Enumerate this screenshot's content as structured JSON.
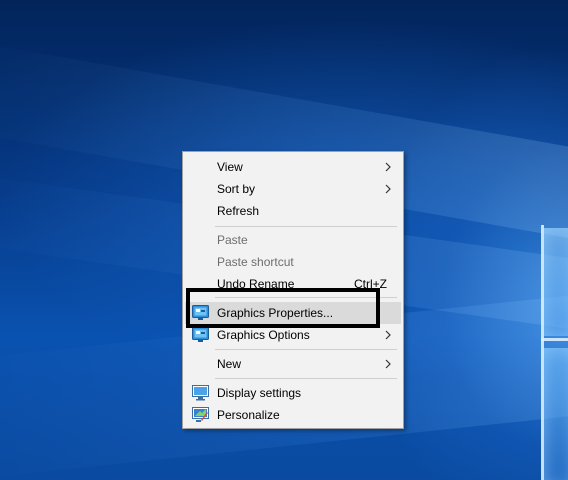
{
  "colors": {
    "menu_background": "#f2f2f2",
    "menu_hover": "#dadada",
    "disabled_text": "#6d6d6d",
    "highlight_box": "#000000",
    "desktop_blue": "#0a52b0"
  },
  "context_menu": {
    "view": {
      "label": "View",
      "has_submenu": true
    },
    "sort_by": {
      "label": "Sort by",
      "has_submenu": true
    },
    "refresh": {
      "label": "Refresh"
    },
    "paste": {
      "label": "Paste",
      "enabled": false
    },
    "paste_shortcut": {
      "label": "Paste shortcut",
      "enabled": false
    },
    "undo_rename": {
      "label": "Undo Rename",
      "shortcut": "Ctrl+Z"
    },
    "graphics_properties": {
      "label": "Graphics Properties...",
      "icon": "intel-graphics-icon",
      "highlighted": true
    },
    "graphics_options": {
      "label": "Graphics Options",
      "icon": "intel-graphics-icon",
      "has_submenu": true
    },
    "new": {
      "label": "New",
      "has_submenu": true
    },
    "display_settings": {
      "label": "Display settings",
      "icon": "display-monitor-icon"
    },
    "personalize": {
      "label": "Personalize",
      "icon": "personalize-monitor-icon"
    }
  }
}
